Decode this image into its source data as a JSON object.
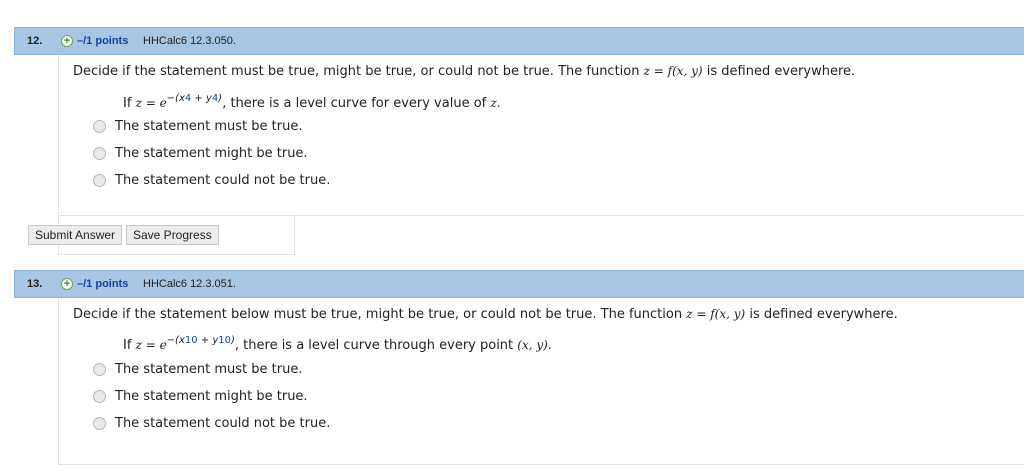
{
  "questions": [
    {
      "number": "12.",
      "points": "–/1 points",
      "source": "HHCalc6 12.3.050.",
      "prompt_text": "Decide if the statement must be true, might be true, or could not be true. The function",
      "prompt_math": "z = f(x, y)",
      "prompt_tail": "is defined everywhere.",
      "statement_if": "If",
      "statement_z": "z = e",
      "exp_open": "−(x",
      "exp_a": "4",
      "exp_plus": " + y",
      "exp_b": "4",
      "exp_close": ")",
      "statement_rest": ", there is a level curve for every value of",
      "statement_var": "z.",
      "options": [
        "The statement must be true.",
        "The statement might be true.",
        "The statement could not be true."
      ],
      "submit_label": "Submit Answer",
      "save_label": "Save Progress"
    },
    {
      "number": "13.",
      "points": "–/1 points",
      "source": "HHCalc6 12.3.051.",
      "prompt_text": "Decide if the statement below must be true, might be true, or could not be true. The function",
      "prompt_math": "z = f(x, y)",
      "prompt_tail": "is defined everywhere.",
      "statement_if": "If",
      "statement_z": "z = e",
      "exp_open": "−(x",
      "exp_a": "10",
      "exp_plus": " + y",
      "exp_b": "10",
      "exp_close": ")",
      "statement_rest": ", there is a level curve through every point",
      "statement_var": "(x, y).",
      "options": [
        "The statement must be true.",
        "The statement might be true.",
        "The statement could not be true."
      ]
    }
  ],
  "colors": {
    "header_bg": "#a6c6e3",
    "points_text": "#1a3fa3",
    "plus_icon": "#3c8d2f"
  }
}
